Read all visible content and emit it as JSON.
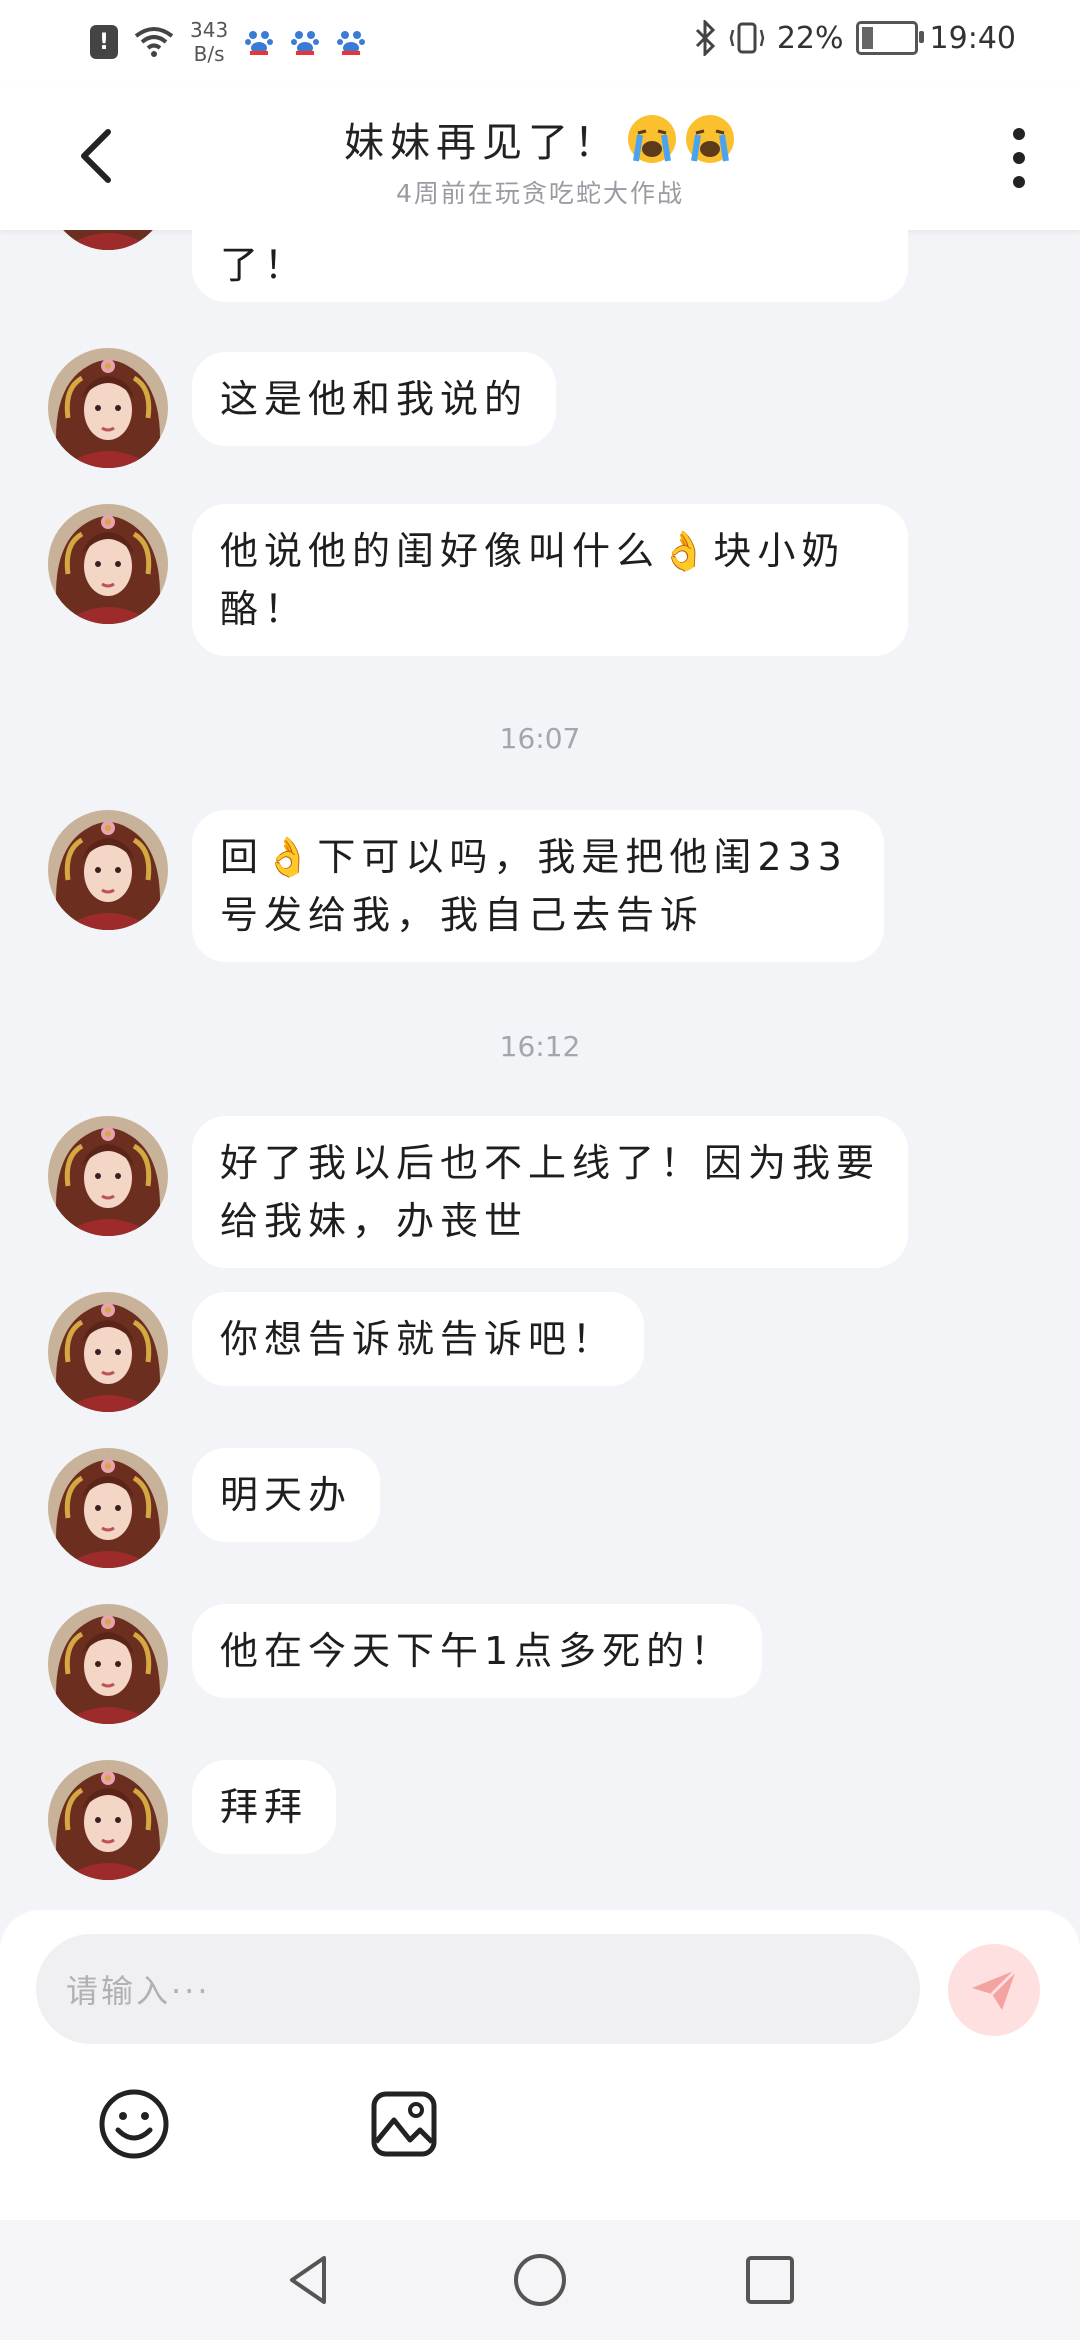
{
  "status_bar": {
    "speed_value": "343",
    "speed_unit": "B/s",
    "battery": "22%",
    "battery_level": 0.22,
    "time": "19:40",
    "icons": [
      "alert-icon",
      "wifi-icon",
      "baidu-paw-icon",
      "bluetooth-icon",
      "vibrate-icon",
      "battery-icon"
    ]
  },
  "header": {
    "title": "妹妹再见了！",
    "subtitle": "4周前在玩贪吃蛇大作战",
    "icons": [
      "back-icon",
      "crying-emoji-icon",
      "more-vert-icon"
    ]
  },
  "messages": [
    {
      "type": "text",
      "text": "了！",
      "partial": true
    },
    {
      "type": "text",
      "text": "这是他和我说的"
    },
    {
      "type": "text",
      "text": "他说他的闺好像叫什么👌块小奶酪！"
    },
    {
      "type": "time",
      "text": "16:07"
    },
    {
      "type": "text",
      "text": "回👌下可以吗，我是把他闺233号发给我，我自己去告诉"
    },
    {
      "type": "time",
      "text": "16:12"
    },
    {
      "type": "text",
      "text": "好了我以后也不上线了！因为我要给我妹，办丧世"
    },
    {
      "type": "text",
      "text": "你想告诉就告诉吧！"
    },
    {
      "type": "text",
      "text": "明天办"
    },
    {
      "type": "text",
      "text": "他在今天下午1点多死的！"
    },
    {
      "type": "text",
      "text": "拜拜"
    }
  ],
  "input": {
    "placeholder": "请输入···"
  },
  "toolbar_icons": [
    "emoji-icon",
    "image-icon",
    "send-icon"
  ],
  "nav_icons": [
    "back-triangle-icon",
    "home-circle-icon",
    "recents-square-icon"
  ],
  "colors": {
    "background": "#f3f4f7",
    "bubble": "#ffffff",
    "send_button": "#fde0df",
    "send_arrow": "#f5a3a0"
  }
}
